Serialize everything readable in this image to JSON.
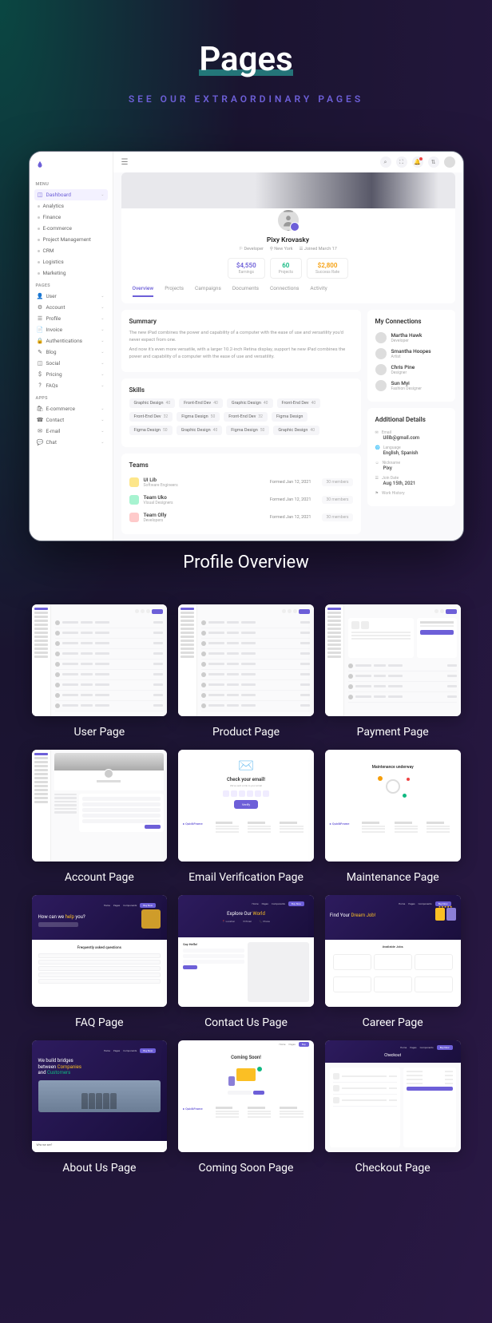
{
  "hero": {
    "title": "Pages",
    "subtitle": "SEE OUR EXTRAORDINARY PAGES"
  },
  "caption_main": "Profile Overview",
  "sidebar": {
    "menu_label": "MENU",
    "pages_label": "PAGES",
    "apps_label": "APPS",
    "menu": [
      {
        "label": "Dashboard",
        "active": true
      },
      {
        "label": "Analytics"
      },
      {
        "label": "Finance"
      },
      {
        "label": "E-commerce"
      },
      {
        "label": "Project Management"
      },
      {
        "label": "CRM"
      },
      {
        "label": "Logistics"
      },
      {
        "label": "Marketing"
      }
    ],
    "pages": [
      {
        "label": "User",
        "icon": "👤"
      },
      {
        "label": "Account",
        "icon": "⚙"
      },
      {
        "label": "Profile",
        "icon": "☰"
      },
      {
        "label": "Invoice",
        "icon": "📄"
      },
      {
        "label": "Authentications",
        "icon": "🔒"
      },
      {
        "label": "Blog",
        "icon": "✎"
      },
      {
        "label": "Social",
        "icon": "◫"
      },
      {
        "label": "Pricing",
        "icon": "$"
      },
      {
        "label": "FAQs",
        "icon": "?"
      }
    ],
    "apps": [
      {
        "label": "E-commerce",
        "icon": "🛍"
      },
      {
        "label": "Contact",
        "icon": "☎"
      },
      {
        "label": "E-mail",
        "icon": "✉"
      },
      {
        "label": "Chat",
        "icon": "💬"
      }
    ]
  },
  "profile": {
    "name": "Pixy Krovasky",
    "meta": [
      {
        "icon": "⚐",
        "text": "Developer"
      },
      {
        "icon": "⚲",
        "text": "New York"
      },
      {
        "icon": "☰",
        "text": "Joined March 17"
      }
    ],
    "stats": [
      {
        "value": "$4,550",
        "label": "Earnings",
        "color": "#6d5fd8"
      },
      {
        "value": "60",
        "label": "Projects",
        "color": "#10b981"
      },
      {
        "value": "$2,800",
        "label": "Success Rate",
        "color": "#f59e0b"
      }
    ],
    "tabs": [
      "Overview",
      "Projects",
      "Campaigns",
      "Documents",
      "Connections",
      "Activity"
    ]
  },
  "summary": {
    "title": "Summary",
    "p1": "The new iPad combines the power and capability of a computer with the ease of use and versatility you'd never expect from one.",
    "p2": "And now it's even more versatile, with a larger 10.2-inch Retina display, support he new iPad combines the power and capability of a computer with the ease of use and versatility."
  },
  "skills": {
    "title": "Skills",
    "items": [
      [
        {
          "name": "Graphic Design",
          "n": "40"
        },
        {
          "name": "Front-End Dev",
          "n": "40"
        },
        {
          "name": "Graphic Design",
          "n": "40"
        },
        {
          "name": "Front-End Dev",
          "n": "40"
        }
      ],
      [
        {
          "name": "Front-End Dev",
          "n": "32"
        },
        {
          "name": "Figma Design",
          "n": "50"
        },
        {
          "name": "Front-End Dev",
          "n": "32"
        },
        {
          "name": "Figma Design"
        }
      ],
      [
        {
          "name": "Figma Design",
          "n": "50"
        },
        {
          "name": "Graphic Design",
          "n": "40"
        },
        {
          "name": "Figma Design",
          "n": "50"
        },
        {
          "name": "Graphic Design",
          "n": "40"
        }
      ]
    ]
  },
  "teams": {
    "title": "Teams",
    "items": [
      {
        "name": "UI Lib",
        "role": "Software Engineers",
        "date": "Formed Jan 12, 2021",
        "members": "30 members",
        "color": "#fde68a"
      },
      {
        "name": "Team Uko",
        "role": "Visual Designers",
        "date": "Formed Jan 12, 2021",
        "members": "30 members",
        "color": "#a7f3d0"
      },
      {
        "name": "Team Olly",
        "role": "Developers",
        "date": "Formed Jan 12, 2021",
        "members": "30 members",
        "color": "#fecaca"
      }
    ]
  },
  "connections": {
    "title": "My Connections",
    "items": [
      {
        "name": "Martha Hawk",
        "role": "Developer"
      },
      {
        "name": "Smantha Hoopes",
        "role": "Artist"
      },
      {
        "name": "Chris Pine",
        "role": "Designer"
      },
      {
        "name": "Sun Myi",
        "role": "Fashion Designer"
      }
    ]
  },
  "details": {
    "title": "Additional Details",
    "items": [
      {
        "label": "Email",
        "value": "Uilib@gmail.com",
        "icon": "✉"
      },
      {
        "label": "Language",
        "value": "English, Spanish",
        "icon": "🌐"
      },
      {
        "label": "Nickname",
        "value": "Pixy",
        "icon": "☺"
      },
      {
        "label": "Join Date",
        "value": "Aug 15th, 2021",
        "icon": "☰"
      },
      {
        "label": "Work History",
        "value": "",
        "icon": "⚑"
      }
    ]
  },
  "thumbs": [
    {
      "caption": "User Page",
      "type": "table"
    },
    {
      "caption": "Product Page",
      "type": "table"
    },
    {
      "caption": "Payment Page",
      "type": "payment"
    },
    {
      "caption": "Account Page",
      "type": "account"
    },
    {
      "caption": "Email Verification Page",
      "type": "email",
      "title": "Check your email!"
    },
    {
      "caption": "Maintenance Page",
      "type": "maint",
      "title": "Maintenance underway"
    },
    {
      "caption": "FAQ Page",
      "type": "faq",
      "title": "How can we help you?",
      "sub": "Frequently asked questions"
    },
    {
      "caption": "Contact Us Page",
      "type": "contact",
      "title": "Explore Our World",
      "sub": "Say Hello!"
    },
    {
      "caption": "Career Page",
      "type": "career",
      "title": "Find Your Dream Job!",
      "sub": "Available Jobs"
    },
    {
      "caption": "About Us Page",
      "type": "about",
      "title": "We build bridges between Companies and Customers"
    },
    {
      "caption": "Coming Soon Page",
      "type": "soon",
      "title": "Coming Soon!"
    },
    {
      "caption": "Checkout Page",
      "type": "checkout",
      "title": "Checkout"
    }
  ]
}
